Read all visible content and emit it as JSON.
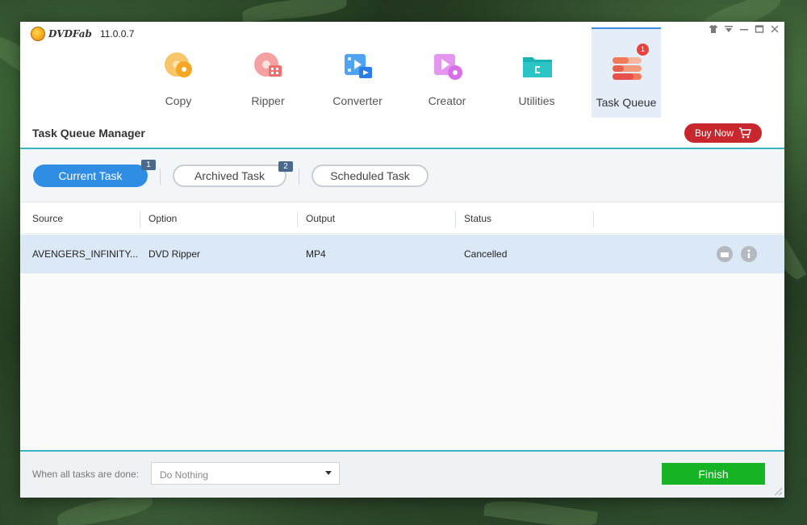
{
  "app": {
    "logo_text": "DVDFab",
    "version": "11.0.0.7"
  },
  "window_controls": [
    "shirt-icon",
    "dropdown-icon",
    "minimize-icon",
    "maximize-icon",
    "close-icon"
  ],
  "toolbar": {
    "items": [
      {
        "label": "Copy",
        "icon": "copy-disc-icon",
        "color": "#f5a623"
      },
      {
        "label": "Ripper",
        "icon": "ripper-disc-icon",
        "color": "#ef6f6f"
      },
      {
        "label": "Converter",
        "icon": "converter-film-icon",
        "color": "#2a7ee8"
      },
      {
        "label": "Creator",
        "icon": "creator-film-icon",
        "color": "#d86fe8"
      },
      {
        "label": "Utilities",
        "icon": "utilities-folder-icon",
        "color": "#19b3b3"
      },
      {
        "label": "Task Queue",
        "icon": "task-queue-icon",
        "color": "#f07a5a",
        "badge": "1",
        "active": true
      }
    ]
  },
  "header": {
    "title": "Task Queue Manager",
    "buy_label": "Buy Now"
  },
  "tabs": [
    {
      "label": "Current Task",
      "count": "1",
      "active": true
    },
    {
      "label": "Archived Task",
      "count": "2",
      "active": false
    },
    {
      "label": "Scheduled Task",
      "count": "",
      "active": false
    }
  ],
  "table": {
    "columns": [
      "Source",
      "Option",
      "Output",
      "Status"
    ],
    "rows": [
      {
        "source": "AVENGERS_INFINITY...",
        "option": "DVD Ripper",
        "output": "MP4",
        "status": "Cancelled"
      }
    ]
  },
  "footer": {
    "label": "When all tasks are done:",
    "select_value": "Do Nothing",
    "finish_label": "Finish"
  },
  "colors": {
    "accent_blue": "#2f8de4",
    "teal_line": "#38b4c8",
    "buy_red": "#c8282d",
    "finish_green": "#16b324",
    "row_selected": "#dbe9f6"
  }
}
